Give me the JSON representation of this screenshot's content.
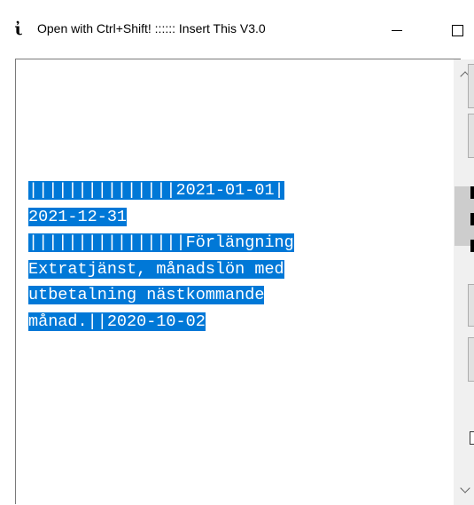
{
  "window": {
    "app_icon_glyph": "ἰ",
    "title": "Open with Ctrl+Shift! :::::: Insert This V3.0",
    "minimize_glyph": "",
    "maximize_glyph": ""
  },
  "editor": {
    "selected": true,
    "selection_color": "#0078d7",
    "lines": [
      "|||||||||||||||2021-01-01|",
      "2021-12-31",
      "||||||||||||||||Förlängning",
      "Extratjänst, månadslön med",
      "utbetalning nästkommande",
      "månad.||2020-10-02"
    ]
  },
  "scrollbar": {
    "up_icon": "chevron-up",
    "down_icon": "chevron-down"
  }
}
